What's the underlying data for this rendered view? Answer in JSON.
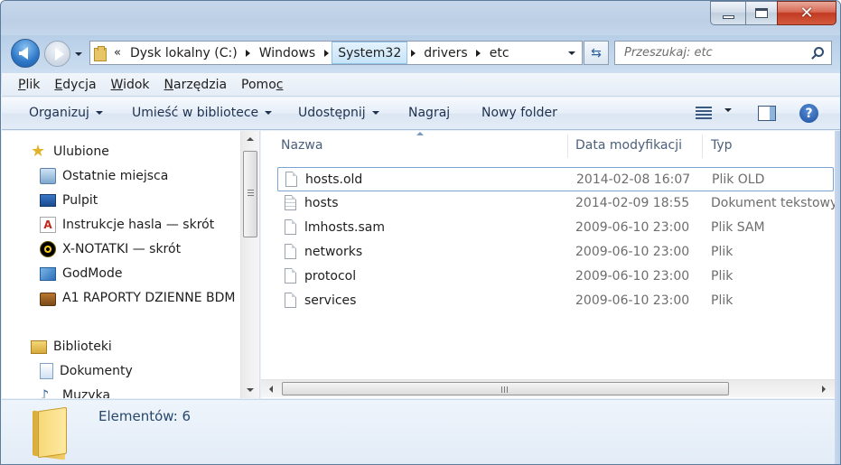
{
  "titlebar": {
    "ghost_text": "",
    "minimize": "minimize",
    "maximize": "maximize",
    "close": "close"
  },
  "address": {
    "overflow": "«",
    "crumbs": [
      "Dysk lokalny (C:)",
      "Windows",
      "System32",
      "drivers",
      "etc"
    ]
  },
  "search": {
    "placeholder": "Przeszukaj: etc"
  },
  "menu": [
    "Plik",
    "Edycja",
    "Widok",
    "Narzędzia",
    "Pomoc"
  ],
  "commands": {
    "organize": "Organizuj",
    "library": "Umieść w bibliotece",
    "share": "Udostępnij",
    "burn": "Nagraj",
    "new_folder": "Nowy folder"
  },
  "nav": {
    "favorites": {
      "header": "Ulubione",
      "items": [
        "Ostatnie miejsca",
        "Pulpit",
        "Instrukcje hasla — skrót",
        "X-NOTATKI — skrót",
        "GodMode",
        "A1 RAPORTY  DZIENNE BDM"
      ]
    },
    "libraries": {
      "header": "Biblioteki",
      "items": [
        "Dokumenty",
        "Muzyka"
      ]
    }
  },
  "columns": {
    "name": "Nazwa",
    "date": "Data modyfikacji",
    "type": "Typ"
  },
  "files": [
    {
      "name": "hosts.old",
      "date": "2014-02-08 16:07",
      "type": "Plik OLD",
      "icon": "file-icon"
    },
    {
      "name": "hosts",
      "date": "2014-02-09 18:55",
      "type": "Dokument tekstowy",
      "icon": "text-file-icon"
    },
    {
      "name": "lmhosts.sam",
      "date": "2009-06-10 23:00",
      "type": "Plik SAM",
      "icon": "file-icon"
    },
    {
      "name": "networks",
      "date": "2009-06-10 23:00",
      "type": "Plik",
      "icon": "file-icon"
    },
    {
      "name": "protocol",
      "date": "2009-06-10 23:00",
      "type": "Plik",
      "icon": "file-icon"
    },
    {
      "name": "services",
      "date": "2009-06-10 23:00",
      "type": "Plik",
      "icon": "file-icon"
    }
  ],
  "status": {
    "count_text": "Elementów: 6"
  },
  "colors": {
    "accent": "#2e78c8",
    "selection_border": "#7aa3d4",
    "close_red": "#c23a22"
  }
}
